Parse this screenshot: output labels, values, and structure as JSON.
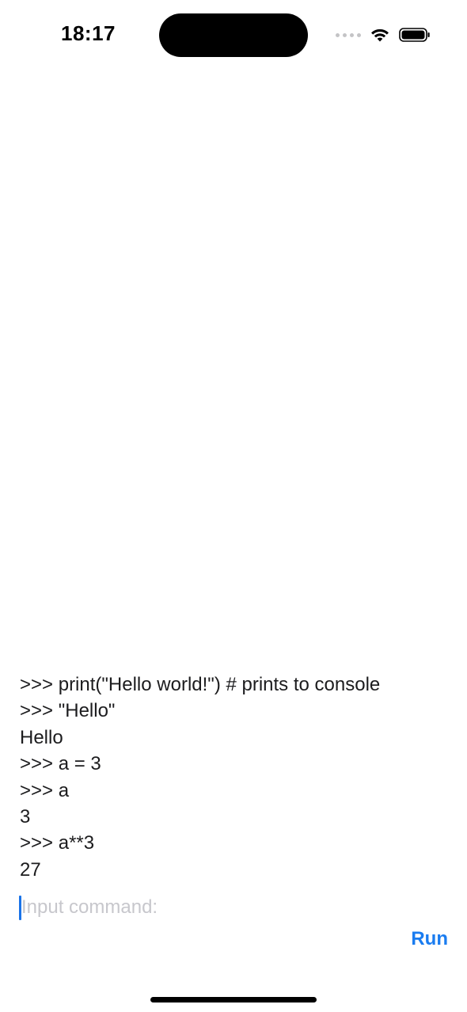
{
  "status_bar": {
    "time": "18:17",
    "icons": [
      "signal-dots-icon",
      "wifi-icon",
      "battery-icon"
    ]
  },
  "console": {
    "lines": [
      ">>> print(\"Hello world!\") # prints to console",
      ">>> \"Hello\"",
      "Hello",
      ">>> a = 3",
      ">>> a",
      "3",
      ">>> a**3",
      "27"
    ]
  },
  "input": {
    "value": "",
    "placeholder": "Input command:"
  },
  "run_button": {
    "label": "Run"
  },
  "colors": {
    "accent": "#1a7cf0",
    "text": "#1c1c1e",
    "placeholder": "#c7c7cc"
  }
}
